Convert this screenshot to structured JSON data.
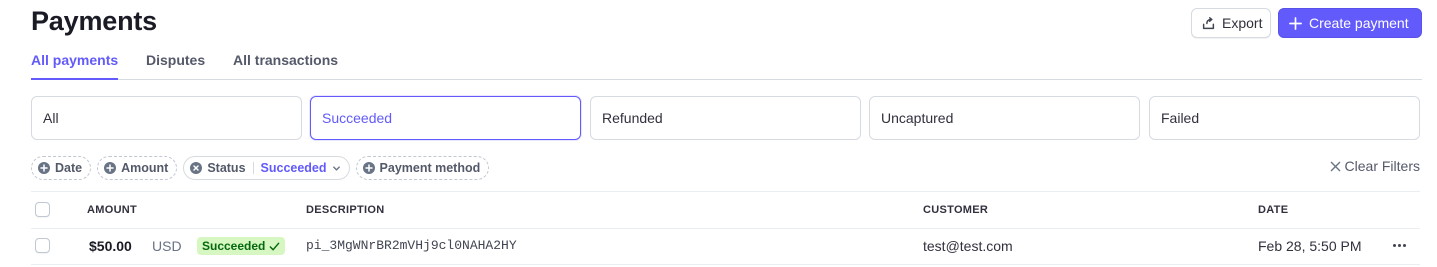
{
  "page": {
    "title": "Payments"
  },
  "actions": {
    "export_label": "Export",
    "create_label": "Create payment"
  },
  "tabs": [
    {
      "label": "All payments",
      "active": true
    },
    {
      "label": "Disputes"
    },
    {
      "label": "All transactions"
    }
  ],
  "status_cards": [
    {
      "label": "All"
    },
    {
      "label": "Succeeded",
      "selected": true
    },
    {
      "label": "Refunded"
    },
    {
      "label": "Uncaptured"
    },
    {
      "label": "Failed"
    }
  ],
  "filters": {
    "date": "Date",
    "amount": "Amount",
    "status": "Status",
    "status_value": "Succeeded",
    "payment_method": "Payment method",
    "clear_label": "Clear Filters"
  },
  "table": {
    "columns": {
      "amount": "AMOUNT",
      "description": "DESCRIPTION",
      "customer": "CUSTOMER",
      "date": "DATE"
    },
    "rows": [
      {
        "amount": "$50.00",
        "currency": "USD",
        "status": "Succeeded",
        "description": "pi_3MgWNrBR2mVHj9cl0NAHA2HY",
        "customer": "test@test.com",
        "date": "Feb 28, 5:50 PM"
      }
    ]
  },
  "colors": {
    "accent": "#625afa",
    "success_bg": "#d7f7c2",
    "success_text": "#05690d"
  }
}
